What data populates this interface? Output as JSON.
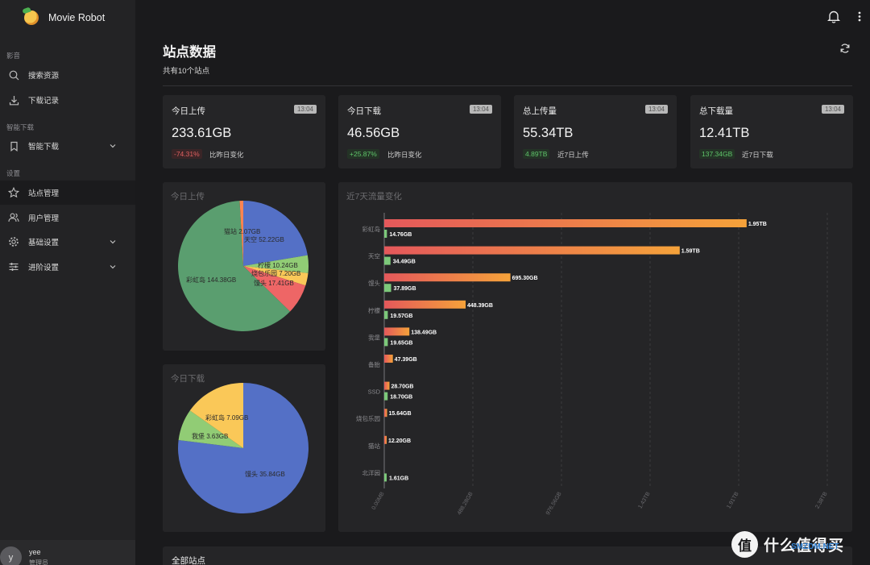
{
  "app": {
    "name": "Movie Robot"
  },
  "sidebar": {
    "sections": [
      {
        "label": "影音",
        "items": [
          {
            "label": "搜索资源",
            "icon": "search-icon"
          },
          {
            "label": "下载记录",
            "icon": "download-icon"
          }
        ]
      },
      {
        "label": "智能下载",
        "items": [
          {
            "label": "智能下载",
            "icon": "bookmark-icon"
          }
        ]
      },
      {
        "label": "设置",
        "items": [
          {
            "label": "站点管理",
            "icon": "star-icon",
            "active": true
          },
          {
            "label": "用户管理",
            "icon": "users-icon"
          },
          {
            "label": "基础设置",
            "icon": "gear-icon"
          },
          {
            "label": "进阶设置",
            "icon": "sliders-icon"
          }
        ]
      }
    ],
    "user": {
      "avatar_letter": "y",
      "name": "yee",
      "role": "管理员"
    }
  },
  "header": {
    "bell_icon": "bell-icon",
    "menu_icon": "more-vertical-icon"
  },
  "page": {
    "title": "站点数据",
    "subtitle": "共有10个站点",
    "refresh_icon": "refresh-icon"
  },
  "stats": [
    {
      "label": "今日上传",
      "time": "13:04",
      "value": "233.61GB",
      "badge": "-74.31%",
      "badge_type": "red",
      "note": "比昨日变化"
    },
    {
      "label": "今日下载",
      "time": "13:04",
      "value": "46.56GB",
      "badge": "+25.87%",
      "badge_type": "green",
      "note": "比昨日变化"
    },
    {
      "label": "总上传量",
      "time": "13:04",
      "value": "55.34TB",
      "badge": "4.89TB",
      "badge_type": "green",
      "note": "近7日上传"
    },
    {
      "label": "总下载量",
      "time": "13:04",
      "value": "12.41TB",
      "badge": "137.34GB",
      "badge_type": "green",
      "note": "近7日下载"
    }
  ],
  "chart_data": [
    {
      "type": "pie",
      "title": "今日上传",
      "labels": [
        "天空",
        "柠檬",
        "烧包乐园",
        "馒头",
        "彩虹岛",
        "猫站"
      ],
      "values": [
        52.22,
        10.24,
        7.2,
        17.41,
        144.38,
        2.07
      ],
      "display": [
        "天空 52.22GB",
        "柠檬 10.24GB",
        "烧包乐园 7.20GB",
        "馒头 17.41GB",
        "彩虹岛 144.38GB",
        "猫站 2.07GB"
      ],
      "colors": [
        "#5470c6",
        "#91cc75",
        "#fac858",
        "#ee6666",
        "#5a9e6f",
        "#fc8452"
      ]
    },
    {
      "type": "pie",
      "title": "今日下载",
      "labels": [
        "馒头",
        "我堡",
        "彩虹岛"
      ],
      "values": [
        35.84,
        3.63,
        7.09
      ],
      "display": [
        "馒头 35.84GB",
        "我堡 3.63GB",
        "彩虹岛 7.09GB"
      ],
      "colors": [
        "#5470c6",
        "#91cc75",
        "#fac858"
      ]
    },
    {
      "type": "bar",
      "title": "近7天流量变化",
      "categories": [
        "彩虹岛",
        "天空",
        "馒头",
        "柠檬",
        "我堡",
        "备胎",
        "SSD",
        "烧包乐园",
        "猫站",
        "北洋园"
      ],
      "series": [
        {
          "values_gb": [
            1996.8,
            1628.2,
            695.3,
            448.39,
            138.49,
            47.39,
            28.7,
            15.64,
            12.2,
            0
          ],
          "labels": [
            "1.95TB",
            "1.59TB",
            "695.30GB",
            "448.39GB",
            "138.49GB",
            "47.39GB",
            "28.70GB",
            "15.64GB",
            "12.20GB",
            ""
          ]
        },
        {
          "values_gb": [
            14.76,
            34.49,
            37.89,
            19.57,
            19.65,
            0,
            18.7,
            0,
            0,
            1.61
          ],
          "labels": [
            "14.76GB",
            "34.49GB",
            "37.89GB",
            "19.57GB",
            "19.65GB",
            "",
            "18.70GB",
            "",
            "",
            "1.61GB"
          ]
        }
      ],
      "x_ticks": [
        "0.00MB",
        "488.28GB",
        "976.56GB",
        "1.43TB",
        "1.91TB",
        "2.38TB"
      ],
      "xlim_gb": [
        0,
        2441.4
      ]
    }
  ],
  "all_sites": {
    "title": "全部站点"
  },
  "watermark": {
    "logo": "值",
    "text": "什么值得买",
    "small": "SMZDM.NET"
  }
}
